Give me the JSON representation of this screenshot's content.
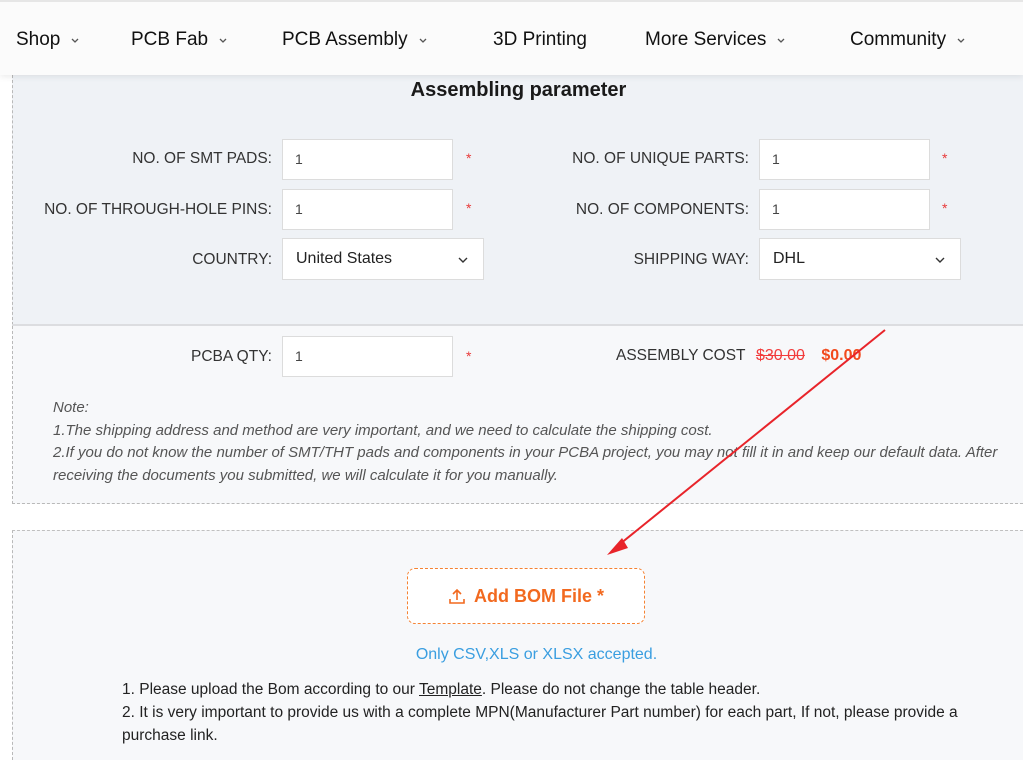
{
  "nav": {
    "items": [
      {
        "label": "Shop",
        "has_dropdown": true
      },
      {
        "label": "PCB Fab",
        "has_dropdown": true
      },
      {
        "label": "PCB Assembly",
        "has_dropdown": true
      },
      {
        "label": "3D Printing",
        "has_dropdown": false
      },
      {
        "label": "More Services",
        "has_dropdown": true
      },
      {
        "label": "Community",
        "has_dropdown": true
      }
    ]
  },
  "assembling": {
    "title": "Assembling parameter",
    "fields": {
      "smt_pads": {
        "label": "NO. OF SMT PADS:",
        "value": "1",
        "required": "*"
      },
      "through_hole_pins": {
        "label": "NO. OF THROUGH-HOLE PINS:",
        "value": "1",
        "required": "*"
      },
      "country": {
        "label": "COUNTRY:",
        "value": "United States"
      },
      "unique_parts": {
        "label": "NO. OF UNIQUE PARTS:",
        "value": "1",
        "required": "*"
      },
      "components": {
        "label": "NO. OF COMPONENTS:",
        "value": "1",
        "required": "*"
      },
      "shipping_way": {
        "label": "SHIPPING WAY:",
        "value": "DHL"
      }
    }
  },
  "quantity": {
    "label": "PCBA QTY:",
    "value": "1",
    "required": "*",
    "cost_label": "ASSEMBLY COST",
    "cost_original": "$30.00",
    "cost_current": "$0.00"
  },
  "note": {
    "heading": "Note:",
    "lines": [
      "1.The shipping address and method are very important, and we need to calculate the shipping cost.",
      "2.If you do not know the number of SMT/THT pads and components in your PCBA project, you may not fill it in and keep our default data. After receiving the documents you submitted, we will calculate it for you manually."
    ]
  },
  "bom": {
    "button_label": "Add BOM File *",
    "button_icon": "upload-icon",
    "accepted_text": "Only CSV,XLS or XLSX accepted.",
    "instruction1_before": "1. Please upload the Bom according to our ",
    "instruction1_link": "Template",
    "instruction1_after": ". Please do not change the table header.",
    "instruction2": "2. It is very important to provide us with a complete MPN(Manufacturer Part number) for each part, If not, please provide a purchase link."
  },
  "colors": {
    "accent_orange": "#f2691f",
    "required_red": "#e83a3a",
    "info_blue": "#3a9ee0",
    "annotation_arrow": "#e8242a"
  }
}
